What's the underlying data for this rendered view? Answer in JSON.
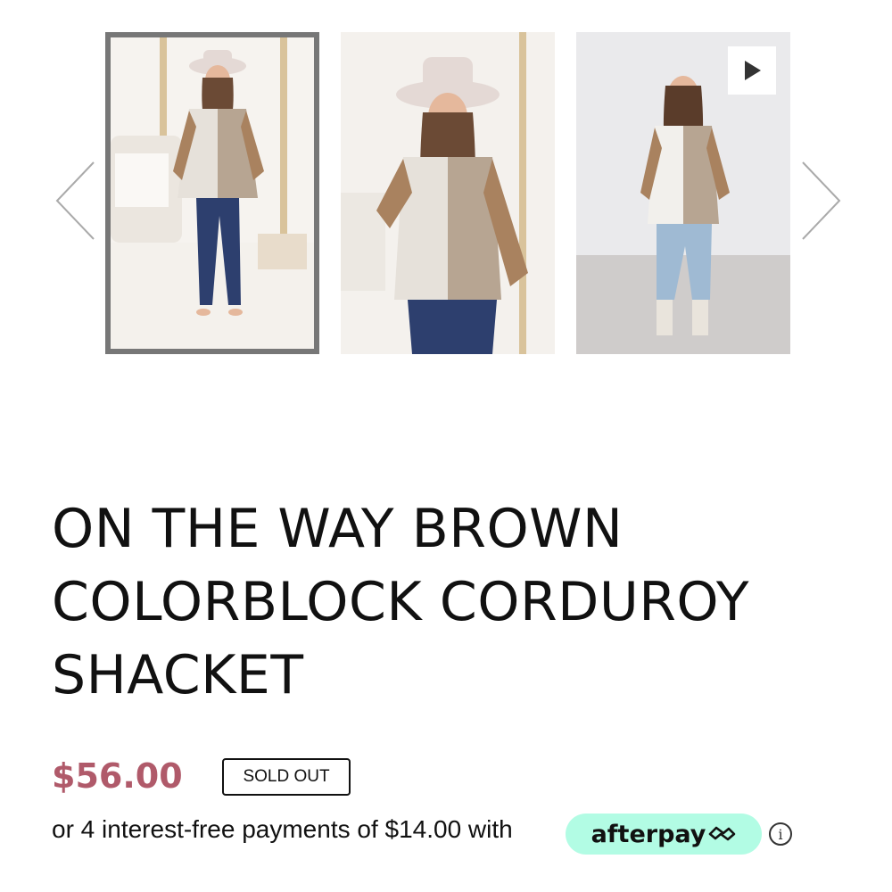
{
  "carousel": {
    "prev_icon": "chevron-left-icon",
    "next_icon": "chevron-right-icon",
    "images": [
      {
        "name": "product-photo-full-length",
        "selected": true
      },
      {
        "name": "product-photo-closeup",
        "selected": false
      },
      {
        "name": "product-video-thumbnail",
        "selected": false,
        "icon": "play-icon"
      }
    ]
  },
  "product": {
    "title_line1": "ON THE WAY BROWN",
    "title_line2": "COLORBLOCK CORDUROY",
    "title_line3": "SHACKET",
    "price": "$56.00",
    "status_badge": "SOLD OUT"
  },
  "payment": {
    "installments_text": "or 4 interest-free payments of $14.00 with",
    "provider_label": "afterpay",
    "provider_color": "#b2fce4",
    "info_icon": "info-icon"
  },
  "colors": {
    "price": "#b05a6a",
    "selected_border": "#777777"
  }
}
